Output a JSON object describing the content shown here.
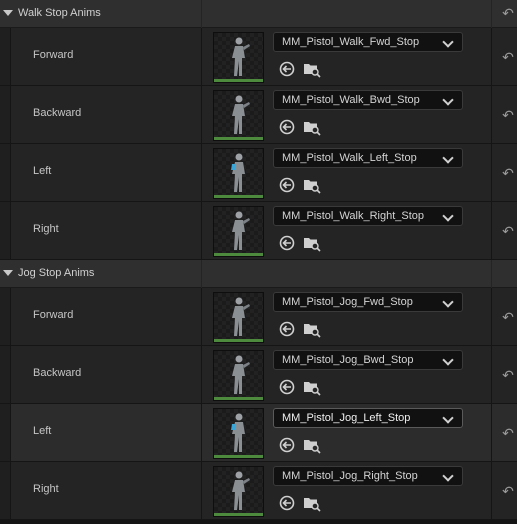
{
  "categories": [
    {
      "title": "Walk Stop Anims",
      "rows": [
        {
          "label": "Forward",
          "asset": "MM_Pistol_Walk_Fwd_Stop"
        },
        {
          "label": "Backward",
          "asset": "MM_Pistol_Walk_Bwd_Stop"
        },
        {
          "label": "Left",
          "asset": "MM_Pistol_Walk_Left_Stop"
        },
        {
          "label": "Right",
          "asset": "MM_Pistol_Walk_Right_Stop"
        }
      ]
    },
    {
      "title": "Jog Stop Anims",
      "rows": [
        {
          "label": "Forward",
          "asset": "MM_Pistol_Jog_Fwd_Stop"
        },
        {
          "label": "Backward",
          "asset": "MM_Pistol_Jog_Bwd_Stop"
        },
        {
          "label": "Left",
          "asset": "MM_Pistol_Jog_Left_Stop"
        },
        {
          "label": "Right",
          "asset": "MM_Pistol_Jog_Right_Stop"
        }
      ]
    }
  ],
  "icons": {
    "expand": "triangle-down-icon",
    "reset": "reset-arrow-icon",
    "use_selected": "use-selected-arrow-icon",
    "browse": "browse-folder-magnifier-icon",
    "combo": "chevron-down-icon"
  },
  "colors": {
    "thumbnail_bar": "#4e8a3e",
    "highlight_row": "#2c2c2c"
  }
}
